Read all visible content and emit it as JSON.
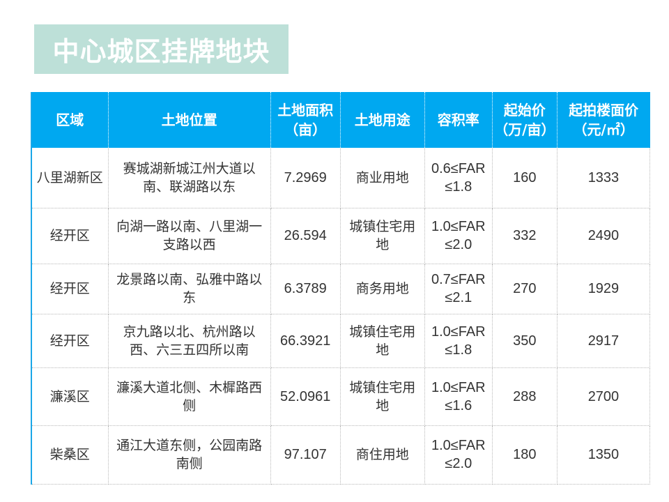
{
  "title": "中心城区挂牌地块",
  "table": {
    "headers": [
      {
        "line1": "区域",
        "line2": ""
      },
      {
        "line1": "土地位置",
        "line2": ""
      },
      {
        "line1": "土地面积",
        "line2": "（亩）"
      },
      {
        "line1": "土地用途",
        "line2": ""
      },
      {
        "line1": "容积率",
        "line2": ""
      },
      {
        "line1": "起始价",
        "line2": "（万/亩）"
      },
      {
        "line1": "起拍楼面价",
        "line2": "（元/㎡）"
      }
    ],
    "rows": [
      {
        "district": "八里湖新区",
        "location": "赛城湖新城江州大道以南、联湖路以东",
        "area": "7.2969",
        "use": "商业用地",
        "far1": "0.6≤FAR",
        "far2": "≤1.8",
        "price": "160",
        "floor_price": "1333"
      },
      {
        "district": "经开区",
        "location": "向湖一路以南、八里湖一支路以西",
        "area": "26.594",
        "use": "城镇住宅用地",
        "far1": "1.0≤FAR",
        "far2": "≤2.0",
        "price": "332",
        "floor_price": "2490"
      },
      {
        "district": "经开区",
        "location": "龙景路以南、弘雅中路以东",
        "area": "6.3789",
        "use": "商务用地",
        "far1": "0.7≤FAR",
        "far2": "≤2.1",
        "price": "270",
        "floor_price": "1929"
      },
      {
        "district": "经开区",
        "location": "京九路以北、杭州路以西、六三五四所以南",
        "area": "66.3921",
        "use": "城镇住宅用地",
        "far1": "1.0≤FAR",
        "far2": "≤1.8",
        "price": "350",
        "floor_price": "2917"
      },
      {
        "district": "濂溪区",
        "location": "濂溪大道北侧、木樨路西侧",
        "area": "52.0961",
        "use": "城镇住宅用地",
        "far1": "1.0≤FAR",
        "far2": "≤1.6",
        "price": "288",
        "floor_price": "2700"
      },
      {
        "district": "柴桑区",
        "location": "通江大道东侧，公园南路南侧",
        "area": "97.107",
        "use": "商住用地",
        "far1": "1.0≤FAR",
        "far2": "≤2.0",
        "price": "180",
        "floor_price": "1350"
      }
    ]
  },
  "colors": {
    "title_bg": "#bde0d8",
    "header_bg": "#00a8f0",
    "accent_border": "#1aa7e8"
  }
}
